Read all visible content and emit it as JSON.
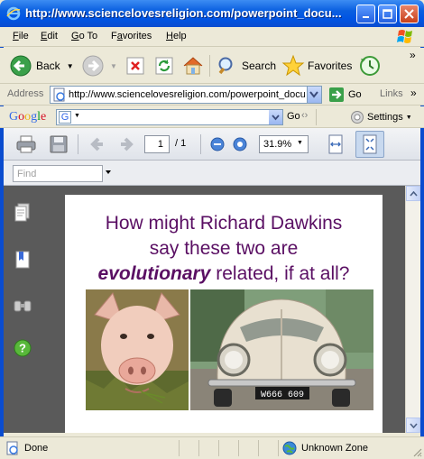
{
  "window": {
    "title": "http://www.sciencelovesreligion.com/powerpoint_docu...",
    "icon": "ie-icon"
  },
  "menubar": {
    "items": [
      {
        "label": "File",
        "key": "F"
      },
      {
        "label": "Edit",
        "key": "E"
      },
      {
        "label": "Go To",
        "key": "G"
      },
      {
        "label": "Favorites",
        "key": "a"
      },
      {
        "label": "Help",
        "key": "H"
      }
    ]
  },
  "toolbar": {
    "back_label": "Back",
    "search_label": "Search",
    "favorites_label": "Favorites",
    "more": "»"
  },
  "address": {
    "label": "Address",
    "url": "http://www.sciencelovesreligion.com/powerpoint_docu",
    "go_label": "Go",
    "links_label": "Links",
    "more": "»"
  },
  "google": {
    "logo": "Google",
    "go_label": "Go",
    "settings_label": "Settings"
  },
  "pdf": {
    "page_current": "1",
    "page_total": "/ 1",
    "zoom": "31.9%"
  },
  "find": {
    "placeholder": "Find"
  },
  "slide": {
    "line1": "How might Richard Dawkins",
    "line2": "say these two are",
    "emphasis": "evolutionary",
    "line3_rest": " related, if at all?",
    "plate": "W666 609"
  },
  "status": {
    "text": "Done",
    "zone": "Unknown Zone"
  },
  "colors": {
    "title_accent": "#0054e3",
    "slide_text": "#5a0f63",
    "doc_bg": "#5a5a5a"
  }
}
